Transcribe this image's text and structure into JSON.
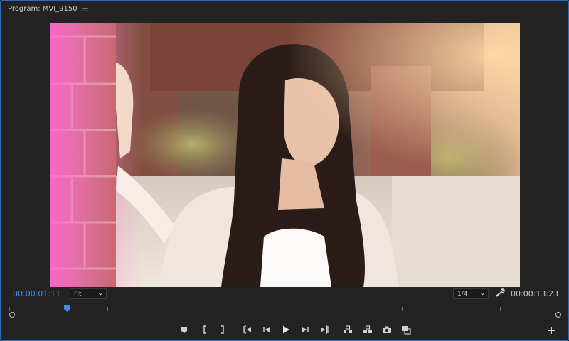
{
  "panel": {
    "title": "Program: MVI_9150",
    "menu_icon": "hamburger-icon"
  },
  "viewer": {
    "description_icon": "video-frame"
  },
  "controls": {
    "current_timecode": "00:00:01:11",
    "zoom_select": "Fit",
    "resolution_select": "1/4",
    "duration_timecode": "00:00:13:23"
  },
  "transport_icons": [
    "add-marker-icon",
    "mark-in-icon",
    "mark-out-icon",
    "go-to-in-icon",
    "step-back-icon",
    "play-icon",
    "step-forward-icon",
    "go-to-out-icon",
    "lift-icon",
    "extract-icon",
    "export-frame-icon",
    "comparison-view-icon",
    "button-editor-icon"
  ],
  "colors": {
    "accent": "#3d8fe6",
    "panel_bg": "#232323",
    "border": "#2d6bb8"
  },
  "playhead_position": 0.1
}
